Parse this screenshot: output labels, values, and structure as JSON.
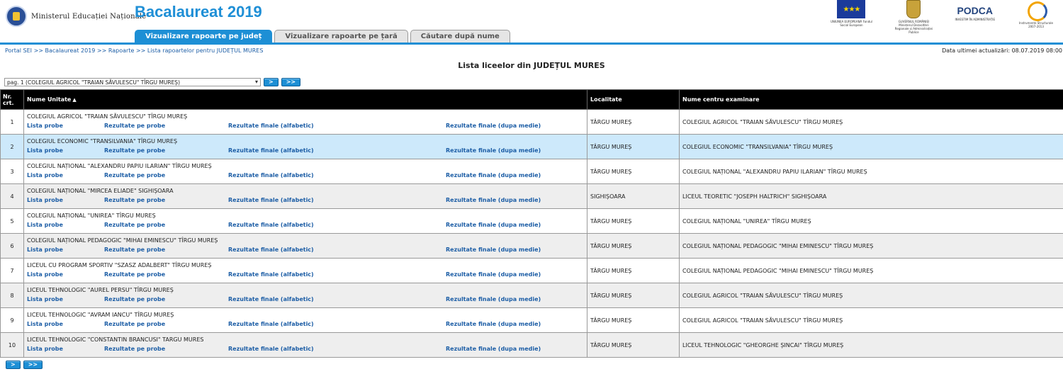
{
  "header": {
    "ministry_name": "Ministerul Educației Naționale",
    "app_title": "Bacalaureat 2019",
    "eu_caption": "UNIUNEA EUROPEANĂ Fondul Social European",
    "gov_caption": "GUVERNUL ROMÂNIEI Ministerul Dezvoltării Regionale și Administrației Publice",
    "podca_label": "PODCA",
    "podca_caption": "INVESTIM ÎN ADMINISTRAȚIE",
    "instr_caption": "Instrumente Structurale 2007-2013"
  },
  "tabs": [
    {
      "label": "Vizualizare rapoarte pe județ",
      "active": true
    },
    {
      "label": "Vizualizare rapoarte pe țară",
      "active": false
    },
    {
      "label": "Căutare după nume",
      "active": false
    }
  ],
  "breadcrumb": "Portal SEI >> Bacalaureat 2019 >> Rapoarte >> Lista rapoartelor pentru JUDEȚUL MURES",
  "last_update": "Data ultimei actualizări: 08.07.2019 08:00",
  "page_heading": "Lista liceelor din JUDEȚUL MURES",
  "pager": {
    "selected_page": "pag. 1 (COLEGIUL AGRICOL \"TRAIAN SĂVULESCU\" TÎRGU MUREȘ)",
    "next_label": ">",
    "last_label": ">>"
  },
  "columns": {
    "nr": "Nr. crt.",
    "unit": "Nume Unitate",
    "locality": "Localitate",
    "exam_center": "Nume centru examinare"
  },
  "link_labels": {
    "probe": "Lista probe",
    "rezultate_probe": "Rezultate pe probe",
    "alfabetic": "Rezultate finale (alfabetic)",
    "medie": "Rezultate finale (dupa medie)"
  },
  "rows": [
    {
      "nr": "1",
      "unit": "COLEGIUL AGRICOL \"TRAIAN SĂVULESCU\" TÎRGU MUREȘ",
      "locality": "TÂRGU MUREȘ",
      "center": "COLEGIUL AGRICOL \"TRAIAN SĂVULESCU\" TÎRGU MUREȘ"
    },
    {
      "nr": "2",
      "unit": "COLEGIUL ECONOMIC \"TRANSILVANIA\" TÎRGU MUREȘ",
      "locality": "TÂRGU MUREȘ",
      "center": "COLEGIUL ECONOMIC \"TRANSILVANIA\" TÎRGU MUREȘ"
    },
    {
      "nr": "3",
      "unit": "COLEGIUL NAȚIONAL \"ALEXANDRU PAPIU ILARIAN\" TÎRGU MUREȘ",
      "locality": "TÂRGU MUREȘ",
      "center": "COLEGIUL NAȚIONAL \"ALEXANDRU PAPIU ILARIAN\" TÎRGU MUREȘ"
    },
    {
      "nr": "4",
      "unit": "COLEGIUL NAȚIONAL \"MIRCEA ELIADE\" SIGHIȘOARA",
      "locality": "SIGHIȘOARA",
      "center": "LICEUL TEORETIC \"JOSEPH HALTRICH\" SIGHIȘOARA"
    },
    {
      "nr": "5",
      "unit": "COLEGIUL NAȚIONAL \"UNIREA\" TÎRGU MUREȘ",
      "locality": "TÂRGU MUREȘ",
      "center": "COLEGIUL NAȚIONAL \"UNIREA\" TÎRGU MUREȘ"
    },
    {
      "nr": "6",
      "unit": "COLEGIUL NAȚIONAL PEDAGOGIC \"MIHAI EMINESCU\" TÎRGU MUREȘ",
      "locality": "TÂRGU MUREȘ",
      "center": "COLEGIUL NAȚIONAL PEDAGOGIC \"MIHAI EMINESCU\" TÎRGU MUREȘ"
    },
    {
      "nr": "7",
      "unit": "LICEUL CU PROGRAM SPORTIV \"SZASZ ADALBERT\" TÎRGU MUREȘ",
      "locality": "TÂRGU MUREȘ",
      "center": "COLEGIUL NAȚIONAL PEDAGOGIC \"MIHAI EMINESCU\" TÎRGU MUREȘ"
    },
    {
      "nr": "8",
      "unit": "LICEUL TEHNOLOGIC \"AUREL PERSU\" TÎRGU MUREȘ",
      "locality": "TÂRGU MUREȘ",
      "center": "COLEGIUL AGRICOL \"TRAIAN SĂVULESCU\" TÎRGU MUREȘ"
    },
    {
      "nr": "9",
      "unit": "LICEUL TEHNOLOGIC \"AVRAM IANCU\" TÎRGU MUREȘ",
      "locality": "TÂRGU MUREȘ",
      "center": "COLEGIUL AGRICOL \"TRAIAN SĂVULESCU\" TÎRGU MUREȘ"
    },
    {
      "nr": "10",
      "unit": "LICEUL TEHNOLOGIC \"CONSTANTIN BRANCUSI\" TARGU MURES",
      "locality": "TÂRGU MUREȘ",
      "center": "LICEUL TEHNOLOGIC \"GHEORGHE ȘINCAI\" TÎRGU MUREȘ"
    }
  ],
  "colors": {
    "accent": "#1d8fd5",
    "link": "#1d5ea6",
    "selected_row": "#cde9fb",
    "header_bg": "#000000"
  }
}
